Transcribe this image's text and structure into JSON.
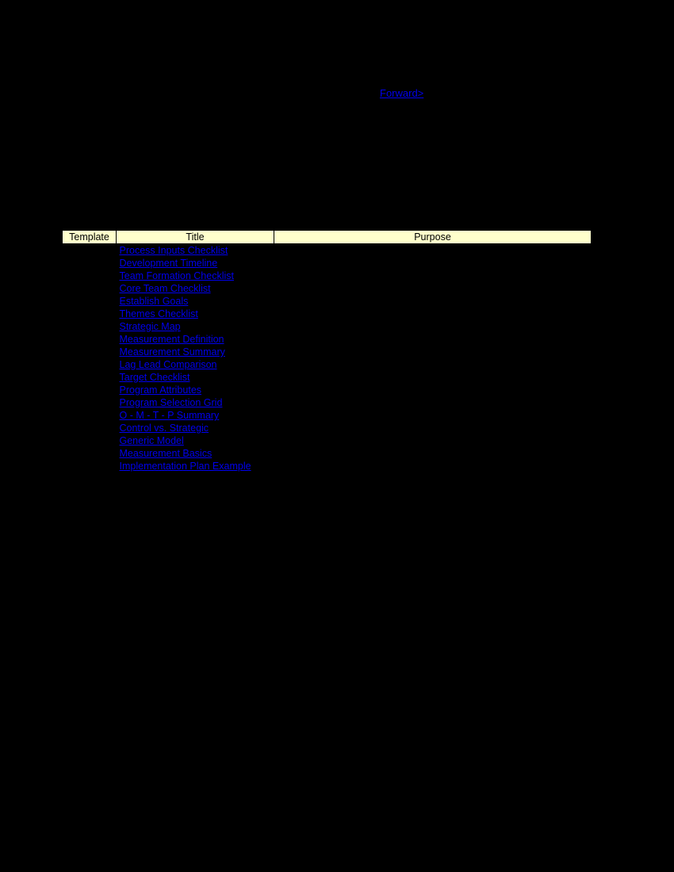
{
  "nav": {
    "forward": "Forward>"
  },
  "table": {
    "headers": {
      "template": "Template",
      "title": "Title",
      "purpose": "Purpose"
    },
    "rows": [
      {
        "title": "Process Inputs Checklist"
      },
      {
        "title": "Development Timeline"
      },
      {
        "title": "Team Formation Checklist"
      },
      {
        "title": "Core Team Checklist"
      },
      {
        "title": "Establish Goals"
      },
      {
        "title": "Themes Checklist"
      },
      {
        "title": "Strategic Map"
      },
      {
        "title": "Measurement Definition"
      },
      {
        "title": "Measurement Summary"
      },
      {
        "title": "Lag Lead Comparison"
      },
      {
        "title": "Target Checklist"
      },
      {
        "title": "Program Attributes"
      },
      {
        "title": "Program Selection Grid"
      },
      {
        "title": "O - M - T - P Summary"
      },
      {
        "title": "Control vs. Strategic"
      },
      {
        "title": "Generic Model"
      },
      {
        "title": "Measurement Basics"
      },
      {
        "title": "Implementation Plan Example"
      }
    ]
  }
}
